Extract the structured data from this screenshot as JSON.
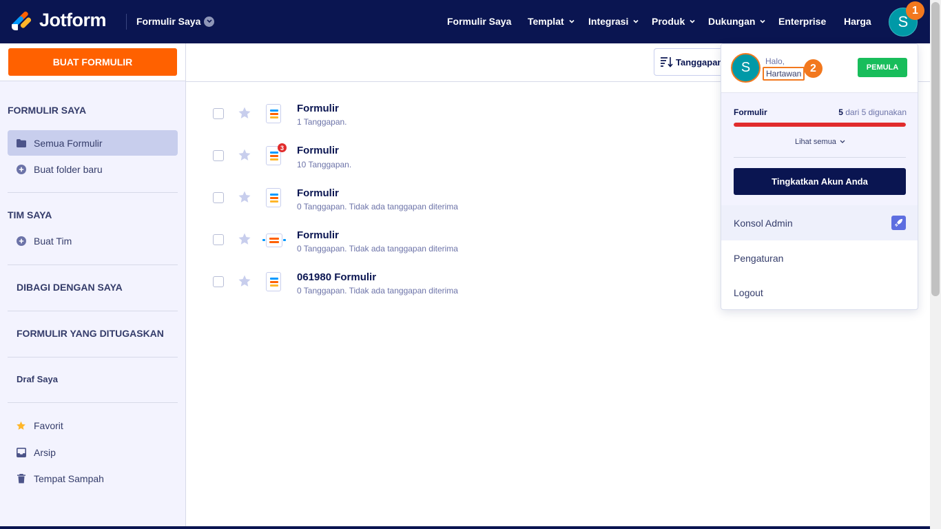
{
  "brand": {
    "name": "Jotform",
    "accent": "#ff6100",
    "navy": "#0a1551"
  },
  "header": {
    "workspace": "Formulir Saya",
    "nav": [
      {
        "label": "Formulir Saya",
        "dropdown": false
      },
      {
        "label": "Templat",
        "dropdown": true
      },
      {
        "label": "Integrasi",
        "dropdown": true
      },
      {
        "label": "Produk",
        "dropdown": true
      },
      {
        "label": "Dukungan",
        "dropdown": true
      },
      {
        "label": "Enterprise",
        "dropdown": false
      },
      {
        "label": "Harga",
        "dropdown": false
      }
    ],
    "avatar_initial": "S",
    "step_badge": "1"
  },
  "sidebar": {
    "create_button": "BUAT FORMULIR",
    "my_forms_title": "FORMULIR SAYA",
    "all_forms": "Semua Formulir",
    "new_folder": "Buat folder baru",
    "my_team_title": "TIM SAYA",
    "create_team": "Buat Tim",
    "shared_with_me": "DIBAGI DENGAN SAYA",
    "assigned_forms": "FORMULIR YANG DITUGASKAN",
    "my_drafts": "Draf Saya",
    "favorites": "Favorit",
    "archive": "Arsip",
    "trash": "Tempat Sampah"
  },
  "toolbar": {
    "sort_label": "Tanggapan"
  },
  "forms": [
    {
      "title": "Formulir",
      "subtitle": "1 Tanggapan.",
      "badge": null,
      "icon": "form-icon"
    },
    {
      "title": "Formulir",
      "subtitle": "10 Tanggapan. ",
      "badge": "3",
      "icon": "form-icon"
    },
    {
      "title": "Formulir",
      "subtitle": "0 Tanggapan. Tidak ada tanggapan diterima",
      "badge": null,
      "icon": "form-icon"
    },
    {
      "title": "Formulir",
      "subtitle": "0 Tanggapan. Tidak ada tanggapan diterima",
      "badge": null,
      "icon": "card-form-icon"
    },
    {
      "title": "061980 Formulir",
      "subtitle": "0 Tanggapan. Tidak ada tanggapan diterima",
      "badge": null,
      "icon": "form-icon"
    }
  ],
  "account_menu": {
    "avatar_initial": "S",
    "greeting": "Halo,",
    "username": "Hartawan",
    "step_badge": "2",
    "plan": "PEMULA",
    "usage_label": "Formulir",
    "usage_used": "5",
    "usage_rest": " dari 5 digunakan",
    "usage_fraction": 1.0,
    "see_all": "Lihat semua",
    "upgrade_button": "Tingkatkan Akun Anda",
    "items": [
      "Konsol Admin",
      "Pengaturan",
      "Logout"
    ]
  }
}
